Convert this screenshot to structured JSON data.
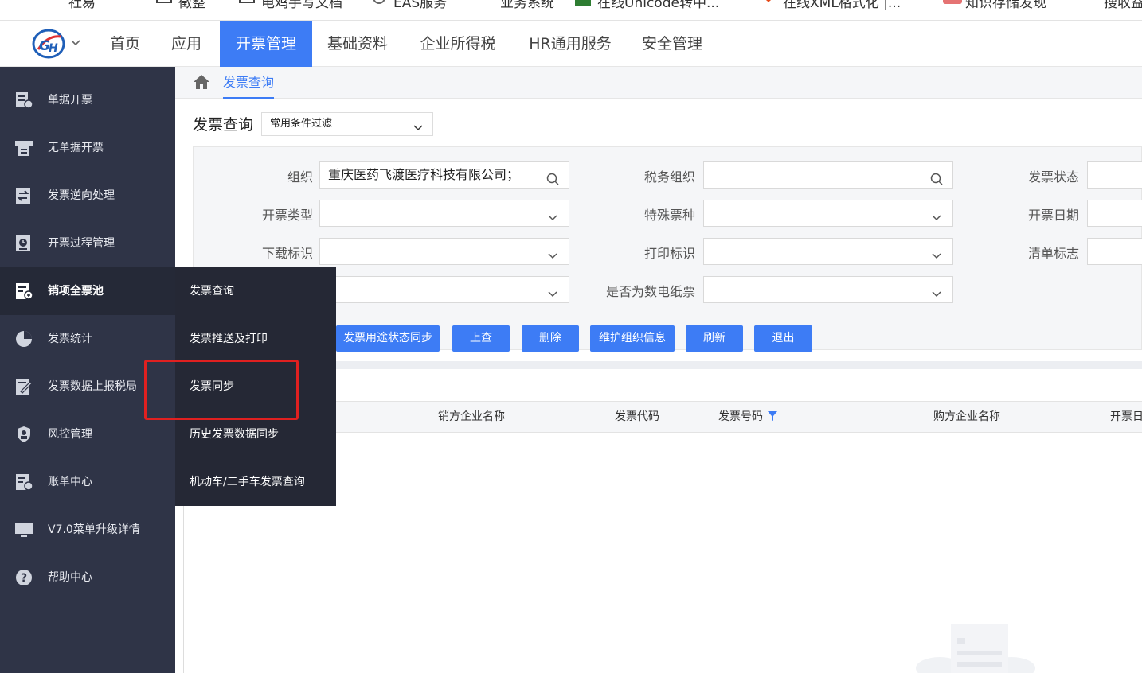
{
  "bookmarks": [
    {
      "label": "社易",
      "color": "#555"
    },
    {
      "label": "徵整",
      "color": "#555"
    },
    {
      "label": "电鸡手写文档",
      "color": "#555"
    },
    {
      "label": "EAS服务",
      "color": "#555"
    },
    {
      "label": "业务系统",
      "color": "#555"
    },
    {
      "label": "在线Unicode转中...",
      "color": "#2e7d32"
    },
    {
      "label": "在线XML格式化 |...",
      "color": "#e64a19"
    },
    {
      "label": "知识存储发现",
      "color": "#e53935"
    },
    {
      "label": "搜收益",
      "color": "#555"
    }
  ],
  "topnav": {
    "items": [
      "首页",
      "应用",
      "开票管理",
      "基础资料",
      "企业所得税",
      "HR通用服务",
      "安全管理"
    ],
    "active_index": 2
  },
  "sidebar": {
    "items": [
      {
        "label": "单据开票",
        "icon": "document-check-icon"
      },
      {
        "label": "无单据开票",
        "icon": "printer-icon"
      },
      {
        "label": "发票逆向处理",
        "icon": "swap-icon"
      },
      {
        "label": "开票过程管理",
        "icon": "clock-doc-icon"
      },
      {
        "label": "销项全票池",
        "icon": "pool-icon"
      },
      {
        "label": "发票统计",
        "icon": "pie-chart-icon"
      },
      {
        "label": "发票数据上报税局",
        "icon": "edit-doc-icon"
      },
      {
        "label": "风控管理",
        "icon": "shield-person-icon"
      },
      {
        "label": "账单中心",
        "icon": "bill-icon"
      },
      {
        "label": "V7.0菜单升级详情",
        "icon": "monitor-icon"
      },
      {
        "label": "帮助中心",
        "icon": "help-icon"
      }
    ],
    "active_index": 4
  },
  "flyout": {
    "items": [
      "发票查询",
      "发票推送及打印",
      "发票同步",
      "历史发票数据同步",
      "机动车/二手车发票查询"
    ],
    "highlighted_index": 2
  },
  "breadcrumb": {
    "current": "发票查询"
  },
  "page": {
    "title": "发票查询",
    "filter_preset": "常用条件过滤"
  },
  "filters": {
    "org_label": "组织",
    "org_value": "重庆医药飞渡医疗科技有限公司；",
    "tax_org_label": "税务组织",
    "tax_org_value": "",
    "status_label": "发票状态",
    "issue_type_label": "开票类型",
    "special_label": "特殊票种",
    "issue_date_label": "开票日期",
    "download_label": "下载标识",
    "print_label": "打印标识",
    "list_label": "清单标志",
    "paper_label": "是否为数电纸票"
  },
  "buttons": [
    "发票用途状态同步",
    "上查",
    "删除",
    "维护组织信息",
    "刷新",
    "退出"
  ],
  "table": {
    "columns": [
      "销方企业名称",
      "发票代码",
      "发票号码",
      "购方企业名称",
      "开票日"
    ]
  },
  "colors": {
    "primary": "#3d7cf5",
    "sidebar": "#2f3447",
    "flyout": "#252835",
    "highlight_box": "#e02020"
  }
}
